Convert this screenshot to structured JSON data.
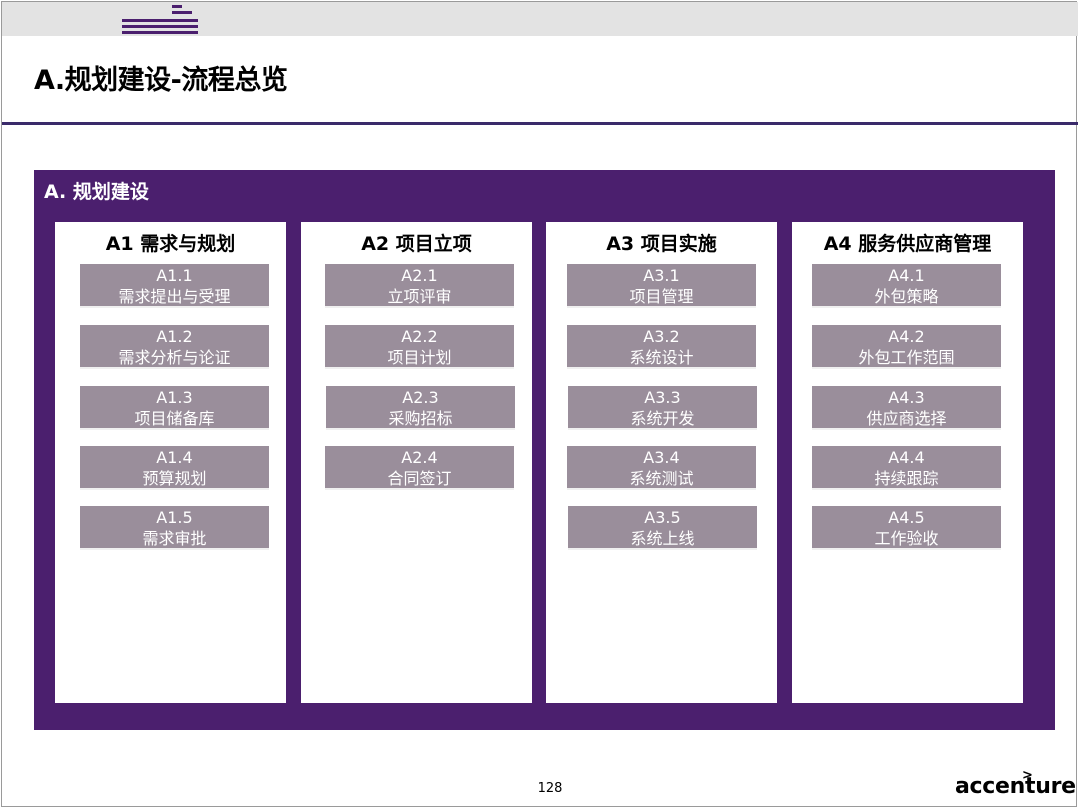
{
  "page": {
    "title": "A.规划建设-流程总览",
    "page_number": "128",
    "logo_text": "accenture"
  },
  "section": {
    "title": "A. 规划建设"
  },
  "columns": [
    {
      "heading": "A1 需求与规划",
      "items": [
        {
          "code": "A1.1",
          "label": "需求提出与受理"
        },
        {
          "code": "A1.2",
          "label": "需求分析与论证"
        },
        {
          "code": "A1.3",
          "label": "项目储备库"
        },
        {
          "code": "A1.4",
          "label": "预算规划"
        },
        {
          "code": "A1.5",
          "label": "需求审批"
        }
      ]
    },
    {
      "heading": "A2 项目立项",
      "items": [
        {
          "code": "A2.1",
          "label": "立项评审"
        },
        {
          "code": "A2.2",
          "label": "项目计划"
        },
        {
          "code": "A2.3",
          "label": "采购招标"
        },
        {
          "code": "A2.4",
          "label": "合同签订"
        }
      ]
    },
    {
      "heading": "A3 项目实施",
      "items": [
        {
          "code": "A3.1",
          "label": "项目管理"
        },
        {
          "code": "A3.2",
          "label": "系统设计"
        },
        {
          "code": "A3.3",
          "label": "系统开发"
        },
        {
          "code": "A3.4",
          "label": "系统测试"
        },
        {
          "code": "A3.5",
          "label": "系统上线"
        }
      ]
    },
    {
      "heading": "A4 服务供应商管理",
      "items": [
        {
          "code": "A4.1",
          "label": "外包策略"
        },
        {
          "code": "A4.2",
          "label": "外包工作范围"
        },
        {
          "code": "A4.3",
          "label": "供应商选择"
        },
        {
          "code": "A4.4",
          "label": "持续跟踪"
        },
        {
          "code": "A4.5",
          "label": "工作验收"
        }
      ]
    }
  ],
  "colors": {
    "panel": "#4b1f6e",
    "item_box": "#9a8e9b",
    "title_rule": "#3a2a6a"
  }
}
